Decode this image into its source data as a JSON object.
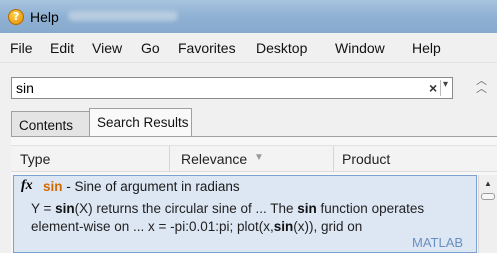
{
  "window": {
    "title": "Help",
    "icon": "matlab-help-icon"
  },
  "menu": [
    "File",
    "Edit",
    "View",
    "Go",
    "Favorites",
    "Desktop",
    "Window",
    "Help"
  ],
  "search": {
    "value": "sin",
    "clear_glyph": "×",
    "dropdown_glyph": "▾",
    "collapse_icon": "double-chevron-up-icon"
  },
  "tabs": [
    {
      "label": "Contents",
      "active": false
    },
    {
      "label": "Search Results",
      "active": true
    }
  ],
  "columns": {
    "type": "Type",
    "relevance": "Relevance",
    "product": "Product",
    "sort_glyph": "▼"
  },
  "result": {
    "type_icon": "fx",
    "name": "sin",
    "summary": " - Sine of argument in radians",
    "desc_parts": [
      "Y = ",
      "sin",
      "(X) returns the circular sine of ... The ",
      "sin",
      " function operates element-wise on ... x = -pi:0.01:pi; plot(x,",
      "sin",
      "(x)), grid on"
    ],
    "product": "MATLAB"
  },
  "colors": {
    "highlight": "#d26a00",
    "selection_bg": "#dde7f4",
    "product_link": "#6b8fc0"
  }
}
